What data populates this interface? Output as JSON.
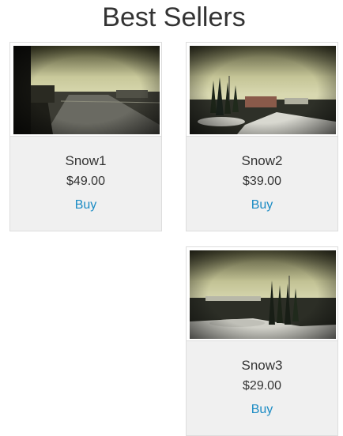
{
  "page": {
    "title": "Best Sellers"
  },
  "products": [
    {
      "name": "Snow1",
      "price": "$49.00",
      "buy_label": "Buy",
      "image": "snowy-road-photo"
    },
    {
      "name": "Snow2",
      "price": "$39.00",
      "buy_label": "Buy",
      "image": "snowy-garden-photo"
    },
    {
      "name": "Snow3",
      "price": "$29.00",
      "buy_label": "Buy",
      "image": "snowy-park-photo"
    }
  ],
  "colors": {
    "link": "#1a8bc4",
    "card_background": "#f0f0f0",
    "border": "#dddddd",
    "text": "#333333"
  }
}
